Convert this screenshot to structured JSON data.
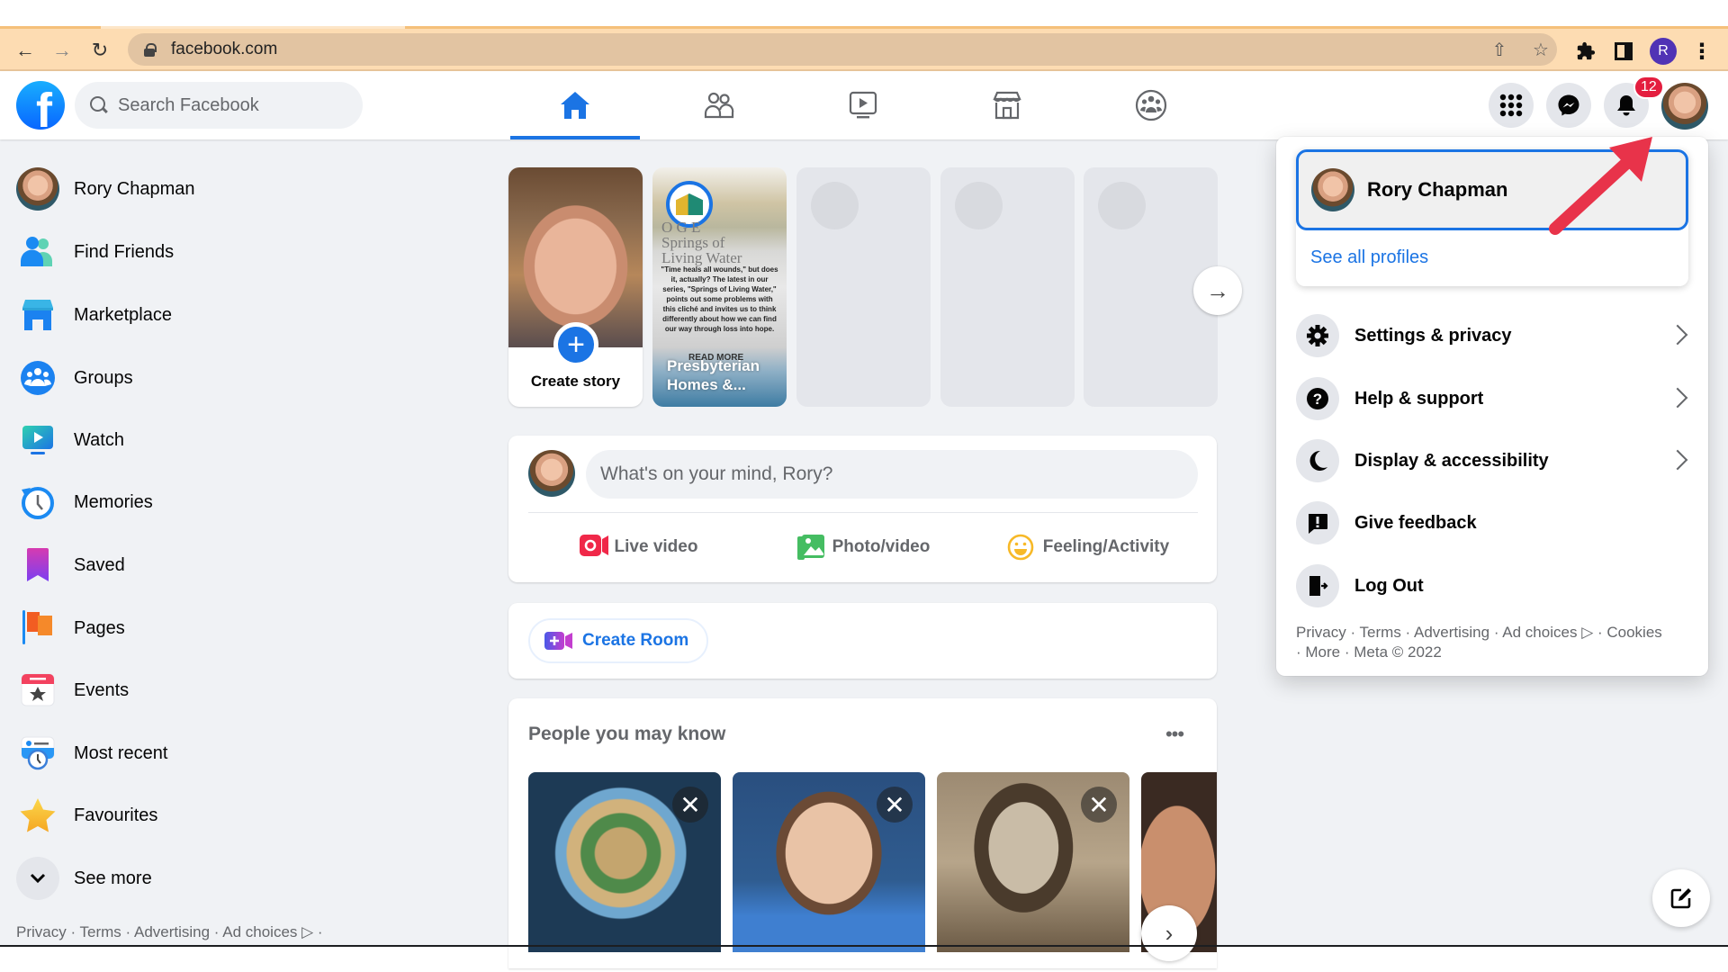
{
  "browser": {
    "url": "facebook.com",
    "profile_initial": "R",
    "icons": [
      "back-arrow-icon",
      "forward-arrow-icon",
      "reload-icon",
      "lock-icon",
      "share-icon",
      "bookmark-star-icon",
      "extensions-puzzle-icon",
      "side-panel-icon",
      "kebab-menu-icon"
    ]
  },
  "header": {
    "logo": "f",
    "search_placeholder": "Search Facebook",
    "tabs": [
      {
        "name": "home",
        "active": true
      },
      {
        "name": "friends",
        "active": false
      },
      {
        "name": "watch",
        "active": false
      },
      {
        "name": "marketplace",
        "active": false
      },
      {
        "name": "groups",
        "active": false
      }
    ],
    "notification_count": "12"
  },
  "sidebar": {
    "items": [
      {
        "label": "Rory Chapman",
        "icon": "avatar"
      },
      {
        "label": "Find Friends",
        "icon": "friends-icon"
      },
      {
        "label": "Marketplace",
        "icon": "marketplace-icon"
      },
      {
        "label": "Groups",
        "icon": "groups-icon"
      },
      {
        "label": "Watch",
        "icon": "watch-icon"
      },
      {
        "label": "Memories",
        "icon": "memories-icon"
      },
      {
        "label": "Saved",
        "icon": "saved-icon"
      },
      {
        "label": "Pages",
        "icon": "pages-flag-icon"
      },
      {
        "label": "Events",
        "icon": "events-calendar-icon"
      },
      {
        "label": "Most recent",
        "icon": "most-recent-icon"
      },
      {
        "label": "Favourites",
        "icon": "favourites-star-icon"
      },
      {
        "label": "See more",
        "icon": "chevron-down-icon"
      }
    ],
    "footer": "Privacy · Terms · Advertising · Ad choices ▷ ·"
  },
  "stories": {
    "create_label": "Create story",
    "items": [
      {
        "title_lines": [
          "O   G E",
          "Springs of",
          "Living Water"
        ],
        "body": "\"Time heals all wounds,\" but does it, actually? The latest in our series, \"Springs of Living Water,\" points out some problems with this cliché and invites us to think differently about how we can find our way through loss into hope.",
        "read_more": "READ MORE",
        "author": "Presbyterian Homes &..."
      }
    ]
  },
  "composer": {
    "placeholder": "What's on your mind, Rory?",
    "actions": [
      {
        "label": "Live video",
        "color": "#f02849"
      },
      {
        "label": "Photo/video",
        "color": "#45bd62"
      },
      {
        "label": "Feeling/Activity",
        "color": "#f7b928"
      }
    ]
  },
  "room": {
    "label": "Create Room"
  },
  "pymk": {
    "title": "People you may know",
    "more": "•••",
    "people": [
      {
        "photo": "earth-in-hand"
      },
      {
        "photo": "man-blue-shirt"
      },
      {
        "photo": "sepia-portrait"
      },
      {
        "photo": "man-closeup"
      }
    ]
  },
  "account_menu": {
    "profile_name": "Rory Chapman",
    "see_all": "See all profiles",
    "items": [
      {
        "label": "Settings & privacy",
        "icon": "gear-icon",
        "has_submenu": true
      },
      {
        "label": "Help & support",
        "icon": "question-icon",
        "has_submenu": true
      },
      {
        "label": "Display & accessibility",
        "icon": "moon-icon",
        "has_submenu": true
      },
      {
        "label": "Give feedback",
        "icon": "feedback-icon",
        "has_submenu": false
      },
      {
        "label": "Log Out",
        "icon": "logout-icon",
        "has_submenu": false
      }
    ],
    "footer_links": [
      "Privacy",
      "Terms",
      "Advertising",
      "Ad choices",
      "Cookies",
      "More",
      "Meta © 2022"
    ]
  },
  "colors": {
    "brand_blue": "#1b74e4",
    "annotation_red": "#e8334a",
    "badge_red": "#e41e3f",
    "page_bg": "#f0f2f5"
  }
}
